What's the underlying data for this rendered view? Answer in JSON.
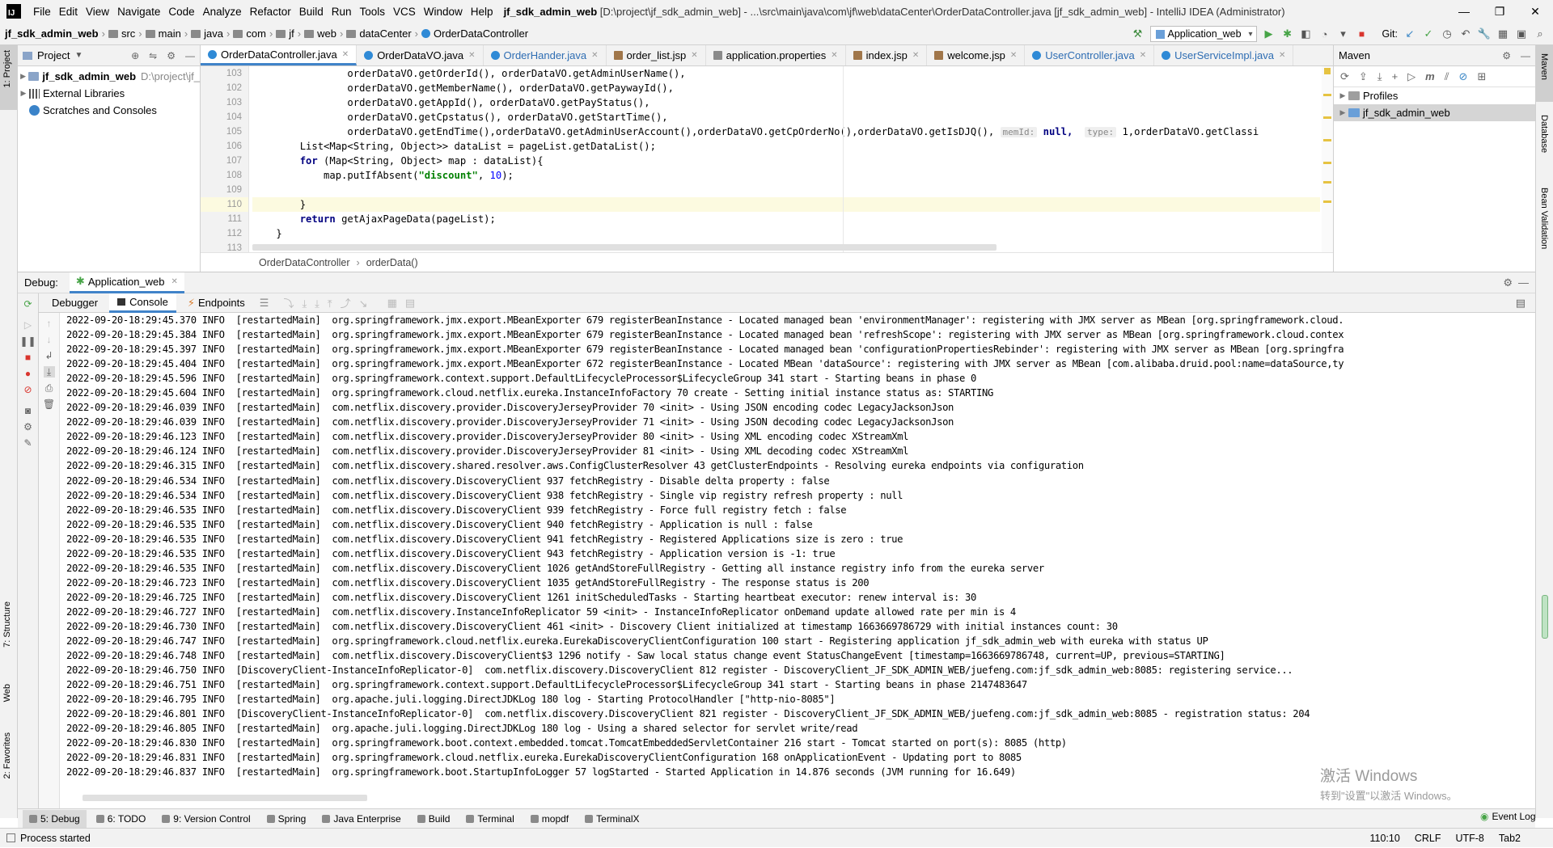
{
  "window": {
    "title_bold": "jf_sdk_admin_web",
    "title_rest": "[D:\\project\\jf_sdk_admin_web] - ...\\src\\main\\java\\com\\jf\\web\\dataCenter\\OrderDataController.java [jf_sdk_admin_web] - IntelliJ IDEA (Administrator)",
    "minimize": "—",
    "restore": "❐",
    "close": "✕"
  },
  "menu": [
    "File",
    "Edit",
    "View",
    "Navigate",
    "Code",
    "Analyze",
    "Refactor",
    "Build",
    "Run",
    "Tools",
    "VCS",
    "Window",
    "Help"
  ],
  "breadcrumbs": [
    "jf_sdk_admin_web",
    "src",
    "main",
    "java",
    "com",
    "jf",
    "web",
    "dataCenter",
    "OrderDataController"
  ],
  "run_config": "Application_web",
  "git_label": "Git:",
  "project_panel": {
    "title": "Project",
    "items": [
      {
        "label": "jf_sdk_admin_web",
        "path": "D:\\project\\jf_"
      },
      {
        "label": "External Libraries"
      },
      {
        "label": "Scratches and Consoles"
      }
    ]
  },
  "editor_tabs": [
    {
      "label": "OrderDataController.java",
      "active": true,
      "color": "#2f8ad6"
    },
    {
      "label": "OrderDataVO.java",
      "color": "#2f8ad6"
    },
    {
      "label": "OrderHander.java",
      "color": "#2f8ad6"
    },
    {
      "label": "order_list.jsp",
      "color": "#a0764a"
    },
    {
      "label": "application.properties",
      "color": "#8a8a8a"
    },
    {
      "label": "index.jsp",
      "color": "#a0764a"
    },
    {
      "label": "welcome.jsp",
      "color": "#a0764a"
    },
    {
      "label": "UserController.java",
      "color": "#2f8ad6"
    },
    {
      "label": "UserServiceImpl.java",
      "color": "#2f8ad6"
    }
  ],
  "line_numbers": [
    "103",
    "102",
    "103",
    "104",
    "105",
    "106",
    "107",
    "108",
    "109",
    "110",
    "111",
    "112",
    "113"
  ],
  "code": {
    "l0": "                orderDataVO.getOrderId(), orderDataVO.getAdminUserName(),",
    "l1": "                orderDataVO.getMemberName(), orderDataVO.getPaywayId(),",
    "l2": "                orderDataVO.getAppId(), orderDataVO.getPayStatus(),",
    "l3": "                orderDataVO.getCpstatus(), orderDataVO.getStartTime(),",
    "l4a": "                orderDataVO.getEndTime(),orderDataVO.getAdminUserAccount(),orderDataVO.getCpOrderNo(),orderDataVO.getIsDJQ(),",
    "l4h1": "memId:",
    "l4k": "null,",
    "l4h2": "type:",
    "l4b": "1,orderDataVO.getClassi",
    "l5": "        List<Map<String, Object>> dataList = pageList.getDataList();",
    "l6k": "for",
    "l6": " (Map<String, Object> map : dataList){",
    "l7a": "            map.putIfAbsent(",
    "l7s": "\"discount\"",
    "l7b": ", ",
    "l7n": "10",
    "l7c": ");",
    "l8": "",
    "l9": "        }",
    "l10k": "return",
    "l10": " getAjaxPageData(pageList);",
    "l11": "    }",
    "l12": ""
  },
  "editor_breadcrumb": [
    "OrderDataController",
    "orderData()"
  ],
  "maven": {
    "title": "Maven",
    "items": [
      "Profiles",
      "jf_sdk_admin_web"
    ]
  },
  "debug": {
    "label": "Debug:",
    "session": "Application_web",
    "tabs": [
      "Debugger",
      "Console",
      "Endpoints"
    ]
  },
  "console_lines": [
    "2022-09-20-18:29:45.370 INFO  [restartedMain]  org.springframework.jmx.export.MBeanExporter 679 registerBeanInstance - Located managed bean 'environmentManager': registering with JMX server as MBean [org.springframework.cloud.",
    "2022-09-20-18:29:45.384 INFO  [restartedMain]  org.springframework.jmx.export.MBeanExporter 679 registerBeanInstance - Located managed bean 'refreshScope': registering with JMX server as MBean [org.springframework.cloud.contex",
    "2022-09-20-18:29:45.397 INFO  [restartedMain]  org.springframework.jmx.export.MBeanExporter 679 registerBeanInstance - Located managed bean 'configurationPropertiesRebinder': registering with JMX server as MBean [org.springfra",
    "2022-09-20-18:29:45.404 INFO  [restartedMain]  org.springframework.jmx.export.MBeanExporter 672 registerBeanInstance - Located MBean 'dataSource': registering with JMX server as MBean [com.alibaba.druid.pool:name=dataSource,ty",
    "2022-09-20-18:29:45.596 INFO  [restartedMain]  org.springframework.context.support.DefaultLifecycleProcessor$LifecycleGroup 341 start - Starting beans in phase 0",
    "2022-09-20-18:29:45.604 INFO  [restartedMain]  org.springframework.cloud.netflix.eureka.InstanceInfoFactory 70 create - Setting initial instance status as: STARTING",
    "2022-09-20-18:29:46.039 INFO  [restartedMain]  com.netflix.discovery.provider.DiscoveryJerseyProvider 70 <init> - Using JSON encoding codec LegacyJacksonJson",
    "2022-09-20-18:29:46.039 INFO  [restartedMain]  com.netflix.discovery.provider.DiscoveryJerseyProvider 71 <init> - Using JSON decoding codec LegacyJacksonJson",
    "2022-09-20-18:29:46.123 INFO  [restartedMain]  com.netflix.discovery.provider.DiscoveryJerseyProvider 80 <init> - Using XML encoding codec XStreamXml",
    "2022-09-20-18:29:46.124 INFO  [restartedMain]  com.netflix.discovery.provider.DiscoveryJerseyProvider 81 <init> - Using XML decoding codec XStreamXml",
    "2022-09-20-18:29:46.315 INFO  [restartedMain]  com.netflix.discovery.shared.resolver.aws.ConfigClusterResolver 43 getClusterEndpoints - Resolving eureka endpoints via configuration",
    "2022-09-20-18:29:46.534 INFO  [restartedMain]  com.netflix.discovery.DiscoveryClient 937 fetchRegistry - Disable delta property : false",
    "2022-09-20-18:29:46.534 INFO  [restartedMain]  com.netflix.discovery.DiscoveryClient 938 fetchRegistry - Single vip registry refresh property : null",
    "2022-09-20-18:29:46.535 INFO  [restartedMain]  com.netflix.discovery.DiscoveryClient 939 fetchRegistry - Force full registry fetch : false",
    "2022-09-20-18:29:46.535 INFO  [restartedMain]  com.netflix.discovery.DiscoveryClient 940 fetchRegistry - Application is null : false",
    "2022-09-20-18:29:46.535 INFO  [restartedMain]  com.netflix.discovery.DiscoveryClient 941 fetchRegistry - Registered Applications size is zero : true",
    "2022-09-20-18:29:46.535 INFO  [restartedMain]  com.netflix.discovery.DiscoveryClient 943 fetchRegistry - Application version is -1: true",
    "2022-09-20-18:29:46.535 INFO  [restartedMain]  com.netflix.discovery.DiscoveryClient 1026 getAndStoreFullRegistry - Getting all instance registry info from the eureka server",
    "2022-09-20-18:29:46.723 INFO  [restartedMain]  com.netflix.discovery.DiscoveryClient 1035 getAndStoreFullRegistry - The response status is 200",
    "2022-09-20-18:29:46.725 INFO  [restartedMain]  com.netflix.discovery.DiscoveryClient 1261 initScheduledTasks - Starting heartbeat executor: renew interval is: 30",
    "2022-09-20-18:29:46.727 INFO  [restartedMain]  com.netflix.discovery.InstanceInfoReplicator 59 <init> - InstanceInfoReplicator onDemand update allowed rate per min is 4",
    "2022-09-20-18:29:46.730 INFO  [restartedMain]  com.netflix.discovery.DiscoveryClient 461 <init> - Discovery Client initialized at timestamp 1663669786729 with initial instances count: 30",
    "2022-09-20-18:29:46.747 INFO  [restartedMain]  org.springframework.cloud.netflix.eureka.EurekaDiscoveryClientConfiguration 100 start - Registering application jf_sdk_admin_web with eureka with status UP",
    "2022-09-20-18:29:46.748 INFO  [restartedMain]  com.netflix.discovery.DiscoveryClient$3 1296 notify - Saw local status change event StatusChangeEvent [timestamp=1663669786748, current=UP, previous=STARTING]",
    "2022-09-20-18:29:46.750 INFO  [DiscoveryClient-InstanceInfoReplicator-0]  com.netflix.discovery.DiscoveryClient 812 register - DiscoveryClient_JF_SDK_ADMIN_WEB/juefeng.com:jf_sdk_admin_web:8085: registering service...",
    "2022-09-20-18:29:46.751 INFO  [restartedMain]  org.springframework.context.support.DefaultLifecycleProcessor$LifecycleGroup 341 start - Starting beans in phase 2147483647",
    "2022-09-20-18:29:46.795 INFO  [restartedMain]  org.apache.juli.logging.DirectJDKLog 180 log - Starting ProtocolHandler [\"http-nio-8085\"]",
    "2022-09-20-18:29:46.801 INFO  [DiscoveryClient-InstanceInfoReplicator-0]  com.netflix.discovery.DiscoveryClient 821 register - DiscoveryClient_JF_SDK_ADMIN_WEB/juefeng.com:jf_sdk_admin_web:8085 - registration status: 204",
    "2022-09-20-18:29:46.805 INFO  [restartedMain]  org.apache.juli.logging.DirectJDKLog 180 log - Using a shared selector for servlet write/read",
    "2022-09-20-18:29:46.830 INFO  [restartedMain]  org.springframework.boot.context.embedded.tomcat.TomcatEmbeddedServletContainer 216 start - Tomcat started on port(s): 8085 (http)",
    "2022-09-20-18:29:46.831 INFO  [restartedMain]  org.springframework.cloud.netflix.eureka.EurekaDiscoveryClientConfiguration 168 onApplicationEvent - Updating port to 8085",
    "2022-09-20-18:29:46.837 INFO  [restartedMain]  org.springframework.boot.StartupInfoLogger 57 logStarted - Started Application in 14.876 seconds (JVM running for 16.649)"
  ],
  "windows_activation": {
    "line1": "激活 Windows",
    "line2": "转到\"设置\"以激活 Windows。"
  },
  "bottom_tools": [
    "5: Debug",
    "6: TODO",
    "9: Version Control",
    "Spring",
    "Java Enterprise",
    "Build",
    "Terminal",
    "mopdf",
    "TerminalX"
  ],
  "event_log": "Event Log",
  "left_stripe": [
    "1: Project",
    "7: Structure",
    "Web",
    "2: Favorites"
  ],
  "right_stripe": [
    "Maven",
    "Database",
    "Bean Validation"
  ],
  "status": {
    "message": "Process started",
    "position": "110:10",
    "line_sep": "CRLF",
    "encoding": "UTF-8",
    "extra": "Tab2"
  },
  "colors": {
    "accent": "#4083c9",
    "panel_bg": "#f2f2f2",
    "caret_line": "#fcfae0"
  }
}
